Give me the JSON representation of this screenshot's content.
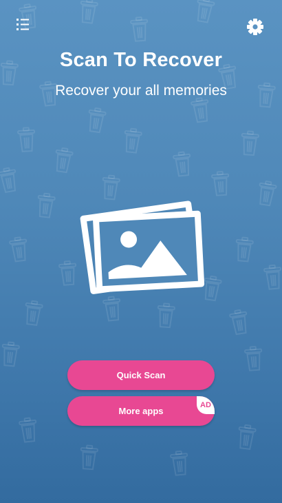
{
  "header": {
    "menu_icon": "list-icon",
    "settings_icon": "gear-icon"
  },
  "hero": {
    "title": "Scan To Recover",
    "subtitle": "Recover your all memories",
    "image_icon": "photos-icon"
  },
  "actions": {
    "quick_scan_label": "Quick Scan",
    "more_apps_label": "More apps",
    "ad_badge": "AD"
  },
  "background": {
    "pattern_icon": "trash-can-icon"
  },
  "colors": {
    "background_top": "#5a93c2",
    "background_bottom": "#336b9f",
    "button": "#e84893",
    "text": "#ffffff"
  }
}
